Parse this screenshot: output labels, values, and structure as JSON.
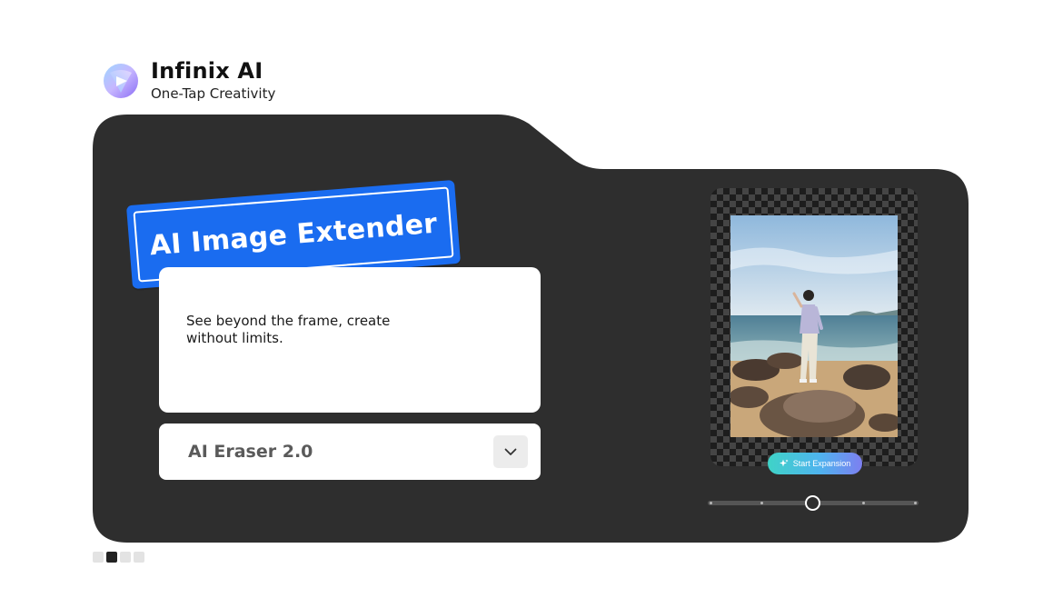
{
  "brand": {
    "name": "Infinix AI",
    "tagline": "One-Tap Creativity"
  },
  "feature": {
    "title": "AI Image Extender",
    "description": "See beyond the frame, create without limits."
  },
  "dropdown": {
    "selected": "AI Eraser 2.0",
    "icon": "chevron-down-icon"
  },
  "preview": {
    "button_label": "Start Expansion",
    "button_icon": "sparkle-icon"
  },
  "slider": {
    "stops": 5,
    "selected_index": 2
  },
  "pagination": {
    "count": 4,
    "active_index": 1
  },
  "colors": {
    "accent_blue": "#1a6cf0",
    "card_bg": "#2e2e2e",
    "button_gradient_start": "#3fd3c7",
    "button_gradient_end": "#7d7ff0"
  }
}
